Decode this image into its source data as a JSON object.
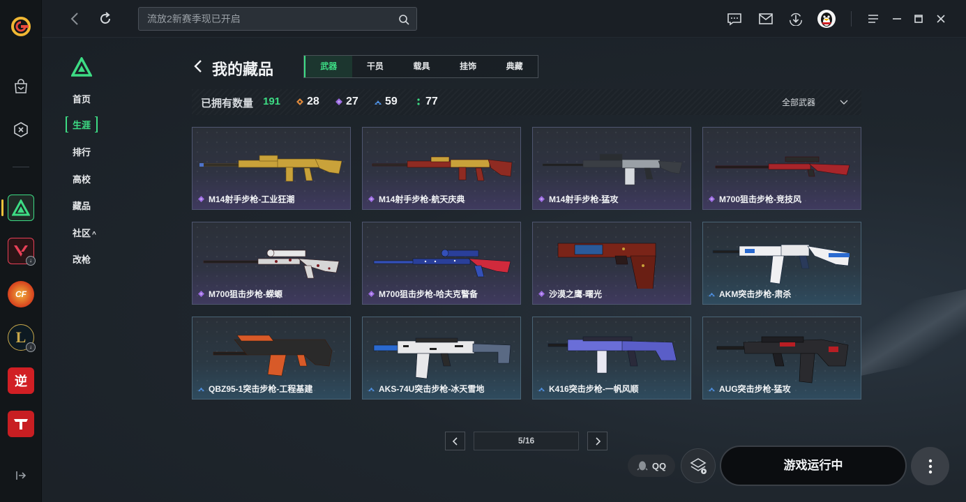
{
  "app": {
    "search": {
      "placeholder": "流放2新赛季现已开启"
    }
  },
  "rail": {
    "games": [
      {
        "icon": "valorant-icon",
        "color": "#e84057",
        "has_download": true
      },
      {
        "icon": "crossfire-icon",
        "color": "#e8552a",
        "has_download": false
      },
      {
        "icon": "league-of-legends-icon",
        "color": "#c8a84b",
        "has_download": true
      },
      {
        "icon": "ni-shui-han-icon",
        "color": "#d11f24",
        "glyph": "逆",
        "has_download": false
      },
      {
        "icon": "tianya-icon",
        "color": "#d11f24",
        "has_download": false
      }
    ]
  },
  "game_nav": {
    "items": [
      "首页",
      "生涯",
      "排行",
      "高校",
      "藏品",
      "社区",
      "改枪"
    ],
    "active_index": 1,
    "community_suffix": "^"
  },
  "collection": {
    "title": "我的藏品",
    "tabs": [
      "武器",
      "干员",
      "载具",
      "挂饰",
      "典藏"
    ],
    "active_tab": 0,
    "owned_label": "已拥有数量",
    "owned_count": "191",
    "rarity_counts": [
      {
        "rarity": "orange",
        "color": "#e08a3c",
        "count": "28"
      },
      {
        "rarity": "purple",
        "color": "#9b6be0",
        "count": "27"
      },
      {
        "rarity": "blue",
        "color": "#4e8fe0",
        "count": "59"
      },
      {
        "rarity": "green",
        "color": "#3ddc84",
        "count": "77"
      }
    ],
    "filter_label": "全部武器",
    "items": [
      {
        "name": "M14射手步枪-工业狂潮",
        "rarity": "purple"
      },
      {
        "name": "M14射手步枪-航天庆典",
        "rarity": "purple"
      },
      {
        "name": "M14射手步枪-猛攻",
        "rarity": "purple"
      },
      {
        "name": "M700狙击步枪-竞技风",
        "rarity": "purple"
      },
      {
        "name": "M700狙击步枪-蝾螈",
        "rarity": "purple"
      },
      {
        "name": "M700狙击步枪-哈夫克警备",
        "rarity": "purple"
      },
      {
        "name": "沙漠之鹰-曙光",
        "rarity": "purple"
      },
      {
        "name": "AKM突击步枪-肃杀",
        "rarity": "blue"
      },
      {
        "name": "QBZ95-1突击步枪-工程基建",
        "rarity": "blue"
      },
      {
        "name": "AKS-74U突击步枪-冰天雪地",
        "rarity": "blue"
      },
      {
        "name": "K416突击步枪-一帆风顺",
        "rarity": "blue"
      },
      {
        "name": "AUG突击步枪-猛攻",
        "rarity": "blue"
      }
    ],
    "pagination": "5/16"
  },
  "launcher": {
    "qq_label": "QQ",
    "launch_label": "游戏运行中"
  },
  "colors": {
    "accent_green": "#3ddc84",
    "purple_gem": "#9b6be0",
    "blue_gem": "#4e8fe0"
  }
}
